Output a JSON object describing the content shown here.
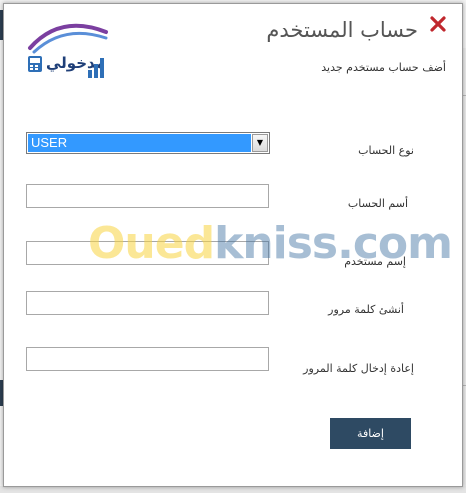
{
  "dialog": {
    "title": "حساب المستخدم",
    "subtitle": "أضف حساب مستخدم جديد",
    "close_icon": "close-icon",
    "close_color": "#c0272d",
    "logo_text": "مدخولي"
  },
  "form": {
    "account_type_label": "نوع الحساب",
    "account_type_value": "USER",
    "account_name_label": "أسم الحساب",
    "account_name_value": "",
    "username_label": "إسم مستخدم",
    "username_value": "",
    "password_label": "أنشئ كلمة مرور",
    "password_value": "",
    "confirm_password_label": "إعادة إدخال كلمة المرور",
    "confirm_password_value": "",
    "submit_label": "إضافة"
  },
  "watermark": {
    "part1": "Oued",
    "part2": "kniss.com"
  },
  "colors": {
    "button_bg": "#2e4a63",
    "select_highlight": "#3399ff"
  }
}
